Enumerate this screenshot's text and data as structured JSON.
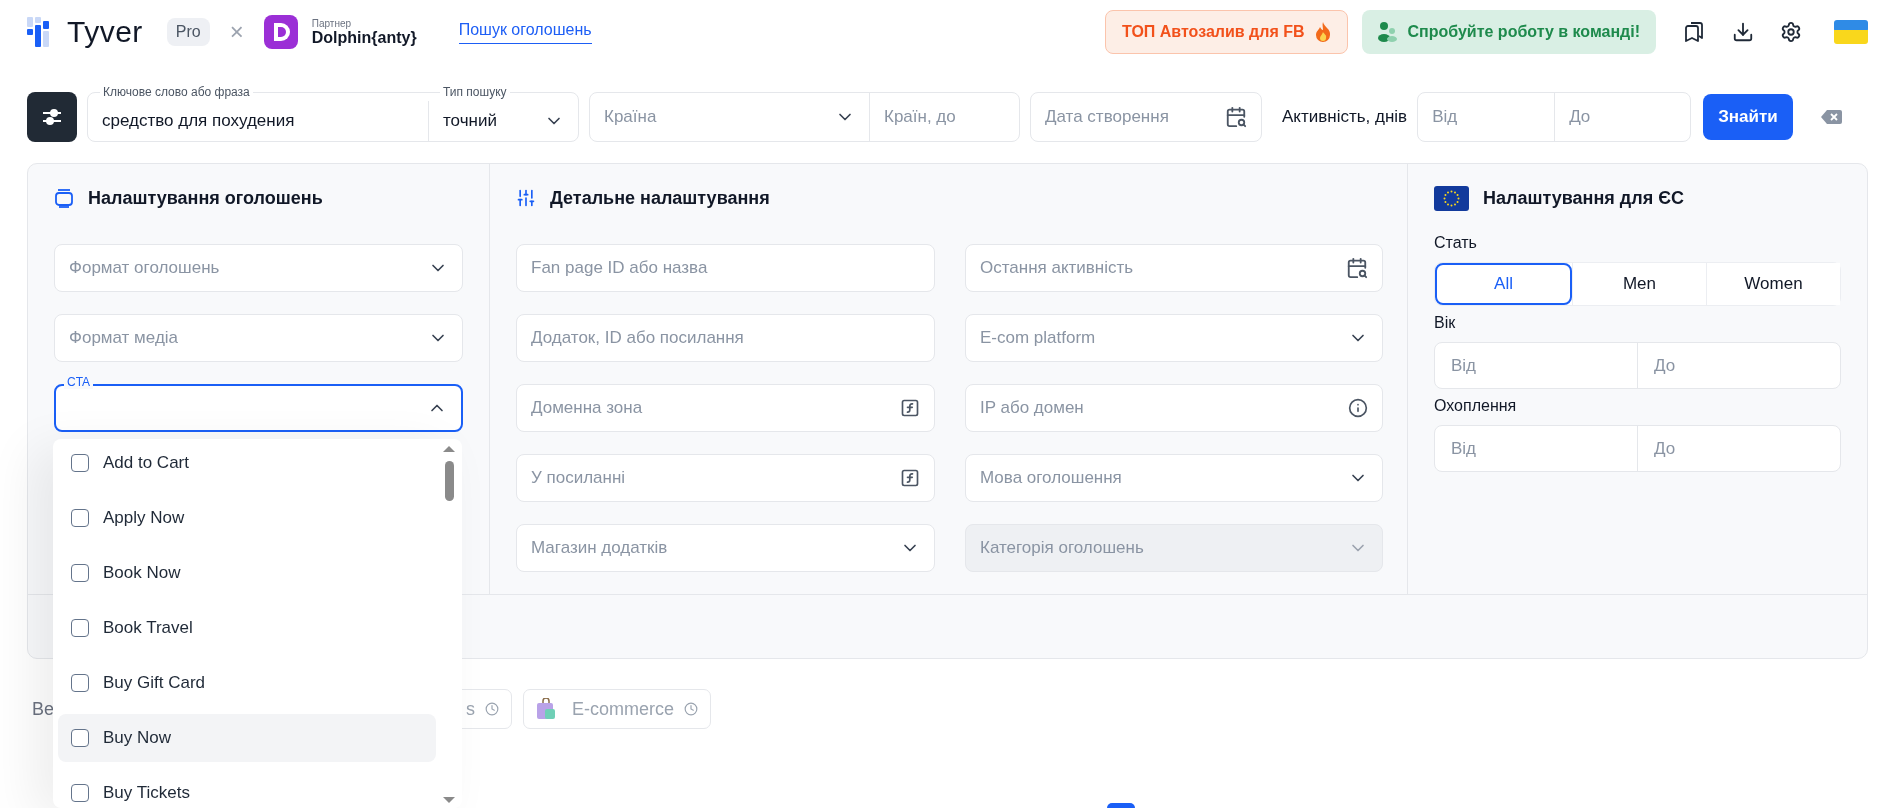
{
  "header": {
    "logo": "Tyver",
    "plan_badge": "Pro",
    "separator": "×",
    "partner_label": "Партнер",
    "partner_name": "Dolphin{anty}",
    "nav_link": "Пошук оголошень",
    "promo_button": "ТОП Автозалив для FB",
    "team_button": "Спробуйте роботу в команді!"
  },
  "search_bar": {
    "keyword": {
      "label": "Ключове слово або фраза",
      "value": "средство для похудения"
    },
    "search_type": {
      "label": "Тип пошуку",
      "value": "точний"
    },
    "country": {
      "placeholder": "Країна"
    },
    "countries_to": {
      "placeholder": "Країн, до"
    },
    "created_date": {
      "placeholder": "Дата створення"
    },
    "activity_label": "Активність, днів",
    "activity_from": {
      "placeholder": "Від"
    },
    "activity_to": {
      "placeholder": "До"
    },
    "submit": "Знайти"
  },
  "ad_settings": {
    "title": "Налаштування оголошень",
    "fields": [
      {
        "kind": "select",
        "placeholder": "Формат оголошень",
        "expanded": false
      },
      {
        "kind": "select",
        "placeholder": "Формат медіа",
        "expanded": false
      },
      {
        "kind": "select",
        "label": "CTA",
        "expanded": true
      }
    ]
  },
  "detail_settings": {
    "title": "Детальне налаштування",
    "fields": [
      {
        "kind": "text",
        "placeholder": "Fan page ID або назва",
        "disabled": false
      },
      {
        "kind": "date",
        "placeholder": "Остання активність",
        "disabled": false
      },
      {
        "kind": "text",
        "placeholder": "Додаток, ID або посилання",
        "disabled": false
      },
      {
        "kind": "select",
        "placeholder": "E-com platform",
        "disabled": false
      },
      {
        "kind": "formula",
        "placeholder": "Доменна зона",
        "disabled": false
      },
      {
        "kind": "info",
        "placeholder": "IP або домен",
        "disabled": false
      },
      {
        "kind": "formula",
        "placeholder": "У посиланні",
        "disabled": false
      },
      {
        "kind": "select",
        "placeholder": "Мова оголошення",
        "disabled": false
      },
      {
        "kind": "select",
        "placeholder": "Магазин додатків",
        "disabled": false
      },
      {
        "kind": "select",
        "placeholder": "Категорія оголошень",
        "disabled": true
      }
    ]
  },
  "eu_settings": {
    "title": "Налаштування для ЄС",
    "gender": {
      "label": "Стать",
      "options": [
        {
          "label": "All",
          "selected": true
        },
        {
          "label": "Men",
          "selected": false
        },
        {
          "label": "Women",
          "selected": false
        }
      ]
    },
    "age": {
      "label": "Вік",
      "from": {
        "placeholder": "Від"
      },
      "to": {
        "placeholder": "До"
      }
    },
    "reach": {
      "label": "Охоплення",
      "from": {
        "placeholder": "Від"
      },
      "to": {
        "placeholder": "До"
      }
    }
  },
  "cta_dropdown": {
    "options": [
      {
        "label": "Add to Cart",
        "checked": false,
        "highlighted": false
      },
      {
        "label": "Apply Now",
        "checked": false,
        "highlighted": false
      },
      {
        "label": "Book Now",
        "checked": false,
        "highlighted": false
      },
      {
        "label": "Book Travel",
        "checked": false,
        "highlighted": false
      },
      {
        "label": "Buy Gift Card",
        "checked": false,
        "highlighted": false
      },
      {
        "label": "Buy Now",
        "checked": false,
        "highlighted": true
      },
      {
        "label": "Buy Tickets",
        "checked": false,
        "highlighted": false
      }
    ]
  },
  "below_panel": {
    "text": "Ве",
    "chips": [
      {
        "label": "s",
        "kind": "plain"
      },
      {
        "label": "E-commerce",
        "kind": "shop"
      }
    ]
  }
}
